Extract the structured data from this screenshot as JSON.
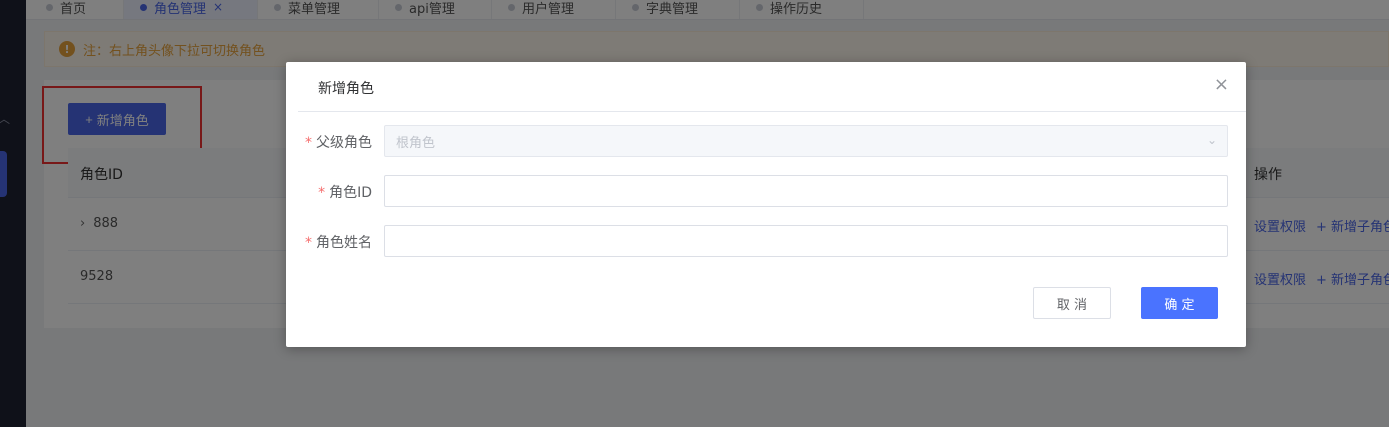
{
  "tabs": [
    {
      "label": "首页"
    },
    {
      "label": "角色管理",
      "close": "×"
    },
    {
      "label": "菜单管理"
    },
    {
      "label": "api管理"
    },
    {
      "label": "用户管理"
    },
    {
      "label": "字典管理"
    },
    {
      "label": "操作历史"
    }
  ],
  "notice": {
    "icon": "!",
    "text": "注：右上角头像下拉可切换角色"
  },
  "toolbar": {
    "add_label": "新增角色",
    "add_icon": "+"
  },
  "table": {
    "headers": {
      "id": "角色ID",
      "ops": "操作"
    },
    "rows": [
      {
        "id": "888",
        "expand": "›",
        "op1": "设置权限",
        "op2": "+ 新增子角色"
      },
      {
        "id": "9528",
        "op1": "设置权限",
        "op2": "+ 新增子角色"
      }
    ]
  },
  "dialog": {
    "title": "新增角色",
    "close": "×",
    "fields": [
      {
        "label": "父级角色",
        "value": "根角色",
        "arrow": "⌄"
      },
      {
        "label": "角色ID",
        "value": ""
      },
      {
        "label": "角色姓名",
        "value": ""
      }
    ],
    "required_mark": "*",
    "cancel_label": "取 消",
    "ok_label": "确 定"
  },
  "colors": {
    "primary": "#4a66e8",
    "warning": "#e6a23c",
    "danger": "#f56c6c",
    "sidebar": "#1f2333"
  }
}
